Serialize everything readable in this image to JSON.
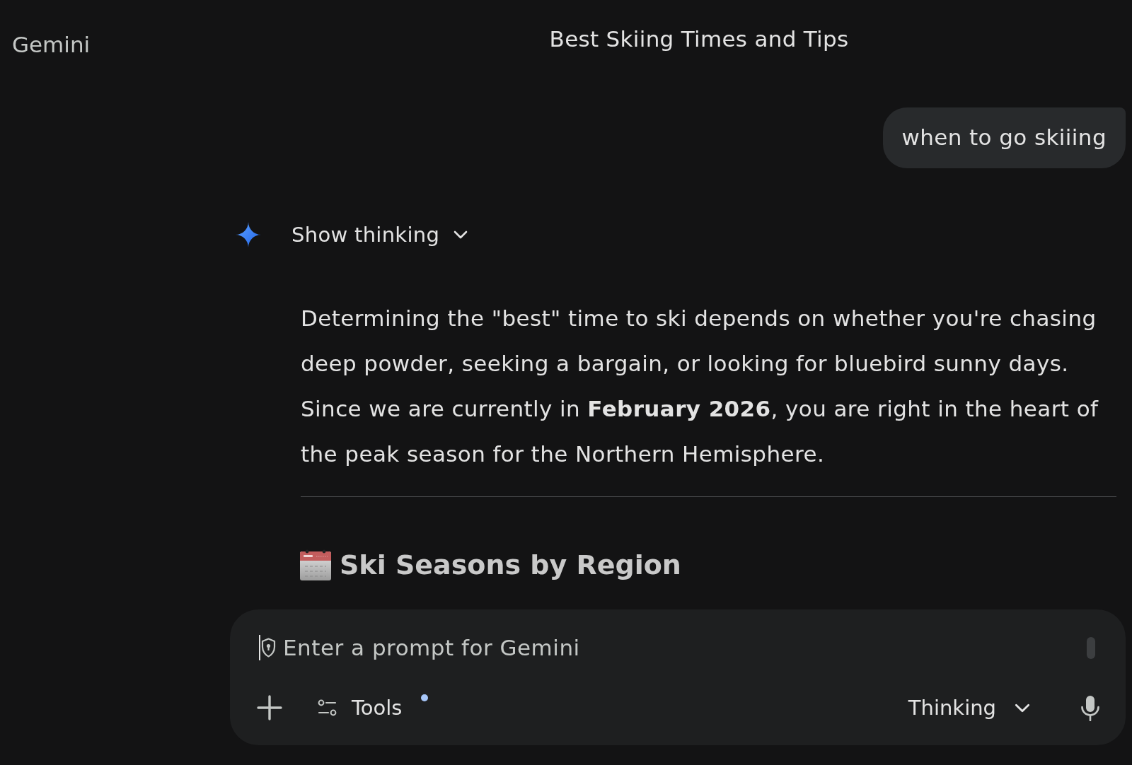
{
  "app": {
    "name": "Gemini"
  },
  "conversation": {
    "title": "Best Skiing Times and Tips"
  },
  "messages": [
    {
      "kind": "user",
      "text": "when to go skiiing"
    },
    {
      "kind": "model",
      "thinking_toggle": {
        "label": "Show thinking",
        "expanded": false
      },
      "blocks": [
        {
          "kind": "paragraph",
          "text": "Determining the \"best\" time to ski depends on whether you're chasing deep powder, seeking a bargain, or looking for bluebird sunny days. Since we are currently in **February 2026**, you are right in the heart of the peak season for the Northern Hemisphere."
        },
        {
          "kind": "divider"
        },
        {
          "kind": "heading",
          "text": "Ski Seasons by Region"
        }
      ]
    }
  ],
  "composer": {
    "placeholder": "Enter a prompt for Gemini",
    "focused": true,
    "tools": {
      "label": "Tools",
      "badge": true
    },
    "mode": {
      "label": "Thinking"
    }
  }
}
